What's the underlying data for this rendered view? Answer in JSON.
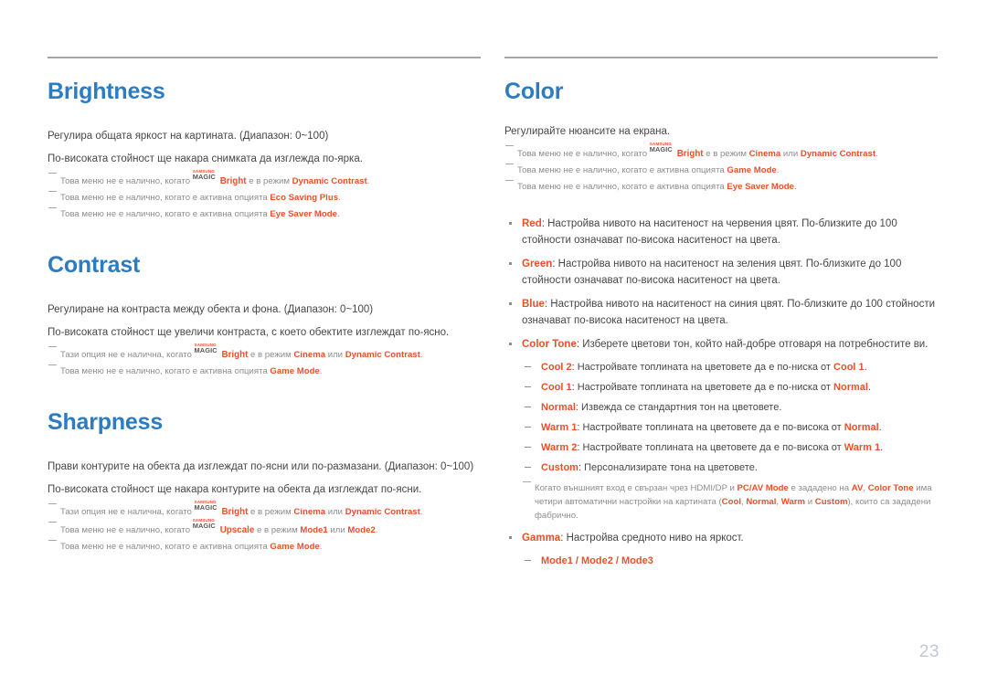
{
  "page": {
    "number": "23",
    "brand_logo": {
      "top": "SAMSUNG",
      "bottom": "MAGIC"
    }
  },
  "left_column": {
    "sections": [
      {
        "title": "Brightness",
        "body": [
          "Регулира общата яркост на картината. (Диапазон: 0~100)",
          "По-високата стойност ще накара снимката да изглежда по-ярка."
        ],
        "notes": [
          {
            "pre": "Това меню не е налично, когато ",
            "logo": true,
            "logo_word": "Bright",
            "mid": " е в режим ",
            "kw1": "Dynamic Contrast",
            "post": "."
          },
          {
            "pre": "Това меню не е налично, когато е активна опцията ",
            "logo": false,
            "kw1": "Eco Saving Plus",
            "post": "."
          },
          {
            "pre": "Това меню не е налично, когато е активна опцията ",
            "logo": false,
            "kw1": "Eye Saver Mode",
            "post": "."
          }
        ]
      },
      {
        "title": "Contrast",
        "body": [
          "Регулиране на контраста между обекта и фона. (Диапазон: 0~100)",
          "По-високата стойност ще увеличи контраста, с което обектите изглеждат по-ясно."
        ],
        "notes": [
          {
            "pre": "Тази опция не е налична, когато ",
            "logo": true,
            "logo_word": "Bright",
            "mid": " е в режим ",
            "kw1": "Cinema",
            "conj": " или ",
            "kw2": "Dynamic Contrast",
            "post": "."
          },
          {
            "pre": "Това меню не е налично, когато е активна опцията ",
            "logo": false,
            "kw1": "Game Mode",
            "post": "."
          }
        ]
      },
      {
        "title": "Sharpness",
        "body": [
          "Прави контурите на обекта да изглеждат по-ясни или по-размазани. (Диапазон: 0~100)",
          "По-високата стойност ще накара контурите на обекта да изглеждат по-ясни."
        ],
        "notes": [
          {
            "pre": "Тази опция не е налична, когато ",
            "logo": true,
            "logo_word": "Bright",
            "mid": " е в режим ",
            "kw1": "Cinema",
            "conj": " или ",
            "kw2": "Dynamic Contrast",
            "post": "."
          },
          {
            "pre": "Това меню не е налично, когато ",
            "logo": true,
            "logo_word": "Upscale",
            "mid": " е в режим ",
            "kw1": "Mode1",
            "conj": " или ",
            "kw2": "Mode2",
            "post": "."
          },
          {
            "pre": "Това меню не е налично, когато е активна опцията ",
            "logo": false,
            "kw1": "Game Mode",
            "post": "."
          }
        ]
      }
    ]
  },
  "right_column": {
    "section": {
      "title": "Color",
      "body": [
        "Регулирайте нюансите на екрана."
      ],
      "notes": [
        {
          "pre": "Това меню не е налично, когато ",
          "logo": true,
          "logo_word": "Bright",
          "mid": " е в режим ",
          "kw1": "Cinema",
          "conj": " или ",
          "kw2": "Dynamic Contrast",
          "post": "."
        },
        {
          "pre": "Това меню не е налично, когато е активна опцията ",
          "logo": false,
          "kw1": "Game Mode",
          "post": "."
        },
        {
          "pre": "Това меню не е налично, когато е активна опцията ",
          "logo": false,
          "kw1": "Eye Saver Mode",
          "post": "."
        }
      ],
      "bullets": [
        {
          "term": "Red",
          "text": ": Настройва нивото на наситеност на червения цвят. По-близките до 100 стойности означават по-висока наситеност на цвета."
        },
        {
          "term": "Green",
          "text": ": Настройва нивото на наситеност на зеления цвят. По-близките до 100 стойности означават по-висока наситеност на цвета."
        },
        {
          "term": "Blue",
          "text": ": Настройва нивото на наситеност на синия цвят. По-близките до 100 стойности означават по-висока наситеност на цвета."
        }
      ],
      "color_tone": {
        "term": "Color Tone",
        "text": ": Изберете цветови тон, който най-добре отговаря на потребностите ви.",
        "items": [
          {
            "term": "Cool 2",
            "pre": ": Настройвате топлината на цветовете да е по-ниска от ",
            "ref": "Cool 1",
            "post": "."
          },
          {
            "term": "Cool 1",
            "pre": ": Настройвате топлината на цветовете да е по-ниска от ",
            "ref": "Normal",
            "post": "."
          },
          {
            "term": "Normal",
            "pre": ": Извежда се стандартния тон на цветовете.",
            "ref": "",
            "post": ""
          },
          {
            "term": "Warm 1",
            "pre": ": Настройвате топлината на цветовете да е по-висока от ",
            "ref": "Normal",
            "post": "."
          },
          {
            "term": "Warm 2",
            "pre": ": Настройвате топлината на цветовете да е по-висока от ",
            "ref": "Warm 1",
            "post": "."
          },
          {
            "term": "Custom",
            "pre": ": Персонализирате тона на цветовете.",
            "ref": "",
            "post": ""
          }
        ],
        "note": {
          "p1": "Когато външният вход е свързан чрез HDMI/DP и ",
          "k1": "PC/AV Mode",
          "p2": " е зададено на ",
          "k2": "AV",
          "p3": ", ",
          "k3": "Color Tone",
          "p4": " има четири автоматични настройки на картината (",
          "k4": "Cool",
          "p5": ", ",
          "k5": "Normal",
          "p6": ", ",
          "k6": "Warm",
          "p7": " и ",
          "k7": "Custom",
          "p8": "), които са зададени фабрично."
        }
      },
      "gamma": {
        "term": "Gamma",
        "text": ": Настройва средното ниво на яркост.",
        "modes": "Mode1 / Mode2 / Mode3"
      }
    }
  }
}
